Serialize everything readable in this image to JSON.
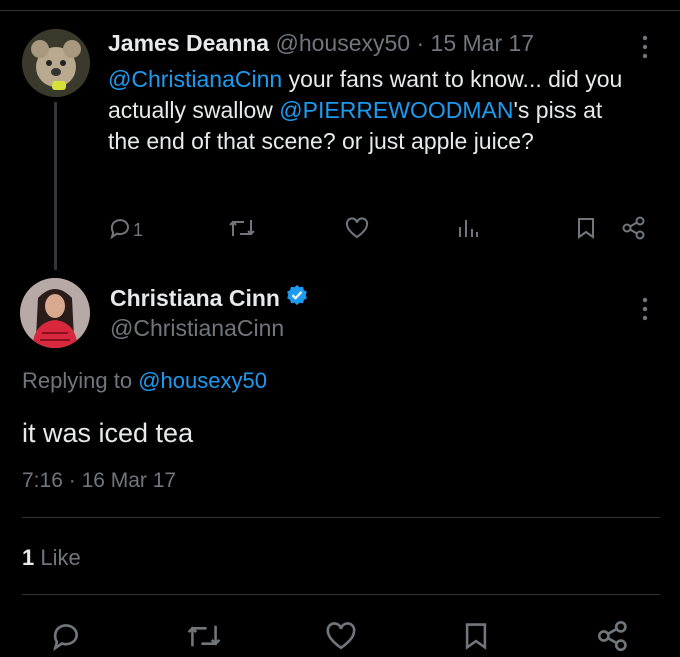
{
  "parent": {
    "name": "James Deanna",
    "handle": "@housexy50",
    "separator": "·",
    "date": "15 Mar 17",
    "mention1": "@ChristianaCinn",
    "text1": " your fans want to know... did you actually swallow ",
    "mention2": "@PIERREWOODMAN",
    "text2": "'s piss at the end of that scene? or just apple juice?",
    "reply_count": "1",
    "icons": [
      "reply-icon",
      "retweet-icon",
      "like-icon",
      "views-icon",
      "bookmark-icon",
      "share-icon"
    ]
  },
  "reply": {
    "name": "Christiana Cinn",
    "handle": "@ChristianaCinn",
    "replying_prefix": "Replying to ",
    "replying_to": "@housexy50",
    "text": "it was iced tea",
    "time": "7:16",
    "separator": "·",
    "date": "16 Mar 17",
    "likes_count": "1",
    "likes_label": " Like"
  },
  "colors": {
    "background": "#000000",
    "text": "#e7e9ea",
    "muted": "#71767b",
    "accent": "#1d9bf0",
    "divider": "#2f3336"
  }
}
